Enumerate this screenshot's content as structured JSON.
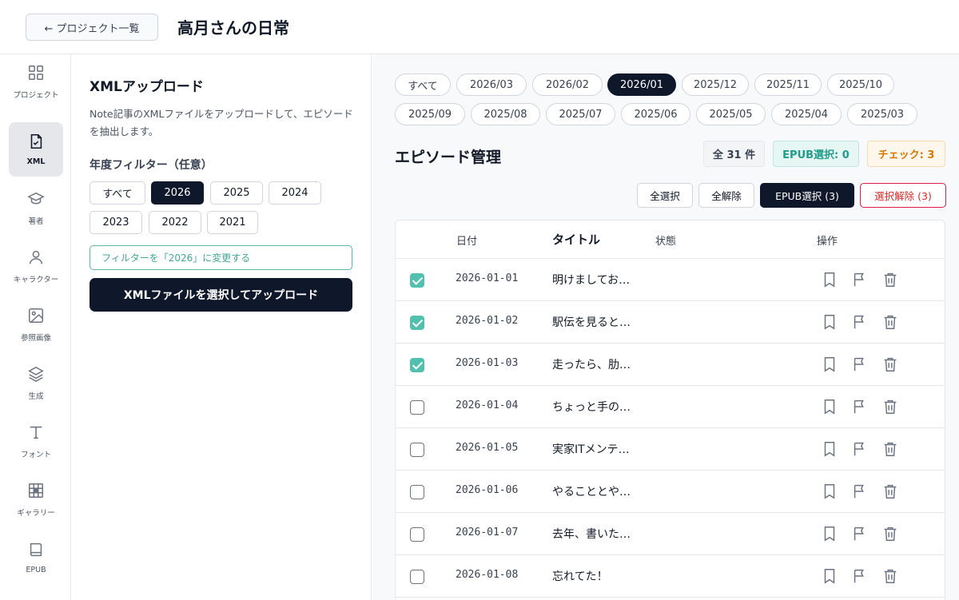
{
  "header": {
    "back_label": "← プロジェクト一覧",
    "title": "高月さんの日常"
  },
  "rail": {
    "items": [
      {
        "label": "プロジェクト",
        "icon": "grid-icon"
      },
      {
        "label": "XML",
        "icon": "file-check-icon"
      },
      {
        "label": "著者",
        "icon": "graduation-cap-icon"
      },
      {
        "label": "キャラクター",
        "icon": "user-icon"
      },
      {
        "label": "参照画像",
        "icon": "image-icon"
      },
      {
        "label": "生成",
        "icon": "layers-icon"
      },
      {
        "label": "フォント",
        "icon": "type-icon"
      },
      {
        "label": "ギャラリー",
        "icon": "gallery-grid-icon"
      },
      {
        "label": "EPUB",
        "icon": "book-icon"
      }
    ],
    "active_index": 1
  },
  "xml_panel": {
    "title": "XMLアップロード",
    "description": "Note記事のXMLファイルをアップロードして、エピソードを抽出します。",
    "year_filter_label": "年度フィルター（任意）",
    "years": [
      "すべて",
      "2026",
      "2025",
      "2024",
      "2023",
      "2022",
      "2021"
    ],
    "active_year": "2026",
    "hint": "フィルターを「2026」に変更する",
    "upload_label": "XMLファイルを選択してアップロード"
  },
  "main": {
    "months": [
      "すべて",
      "2026/03",
      "2026/02",
      "2026/01",
      "2025/12",
      "2025/11",
      "2025/10",
      "2025/09",
      "2025/08",
      "2025/07",
      "2025/06",
      "2025/05",
      "2025/04",
      "2025/03"
    ],
    "active_month": "2026/01",
    "title": "エピソード管理",
    "badges": {
      "total": "全 31 件",
      "epub": "EPUB選択: 0",
      "check": "チェック: 3"
    },
    "actions": {
      "select_all": "全選択",
      "deselect_all": "全解除",
      "epub_select": "EPUB選択 (3)",
      "clear_selection": "選択解除 (3)"
    },
    "table": {
      "headers": {
        "date": "日付",
        "title": "タイトル",
        "status": "状態",
        "ops": "操作"
      },
      "rows": [
        {
          "checked": true,
          "date": "2026-01-01",
          "title": "明けましてお…"
        },
        {
          "checked": true,
          "date": "2026-01-02",
          "title": "駅伝を見ると…"
        },
        {
          "checked": true,
          "date": "2026-01-03",
          "title": "走ったら、肋…"
        },
        {
          "checked": false,
          "date": "2026-01-04",
          "title": "ちょっと手の…"
        },
        {
          "checked": false,
          "date": "2026-01-05",
          "title": "実家ITメンテ…"
        },
        {
          "checked": false,
          "date": "2026-01-06",
          "title": "やることとや…"
        },
        {
          "checked": false,
          "date": "2026-01-07",
          "title": "去年、書いた…"
        },
        {
          "checked": false,
          "date": "2026-01-08",
          "title": "忘れてた！"
        }
      ]
    }
  }
}
